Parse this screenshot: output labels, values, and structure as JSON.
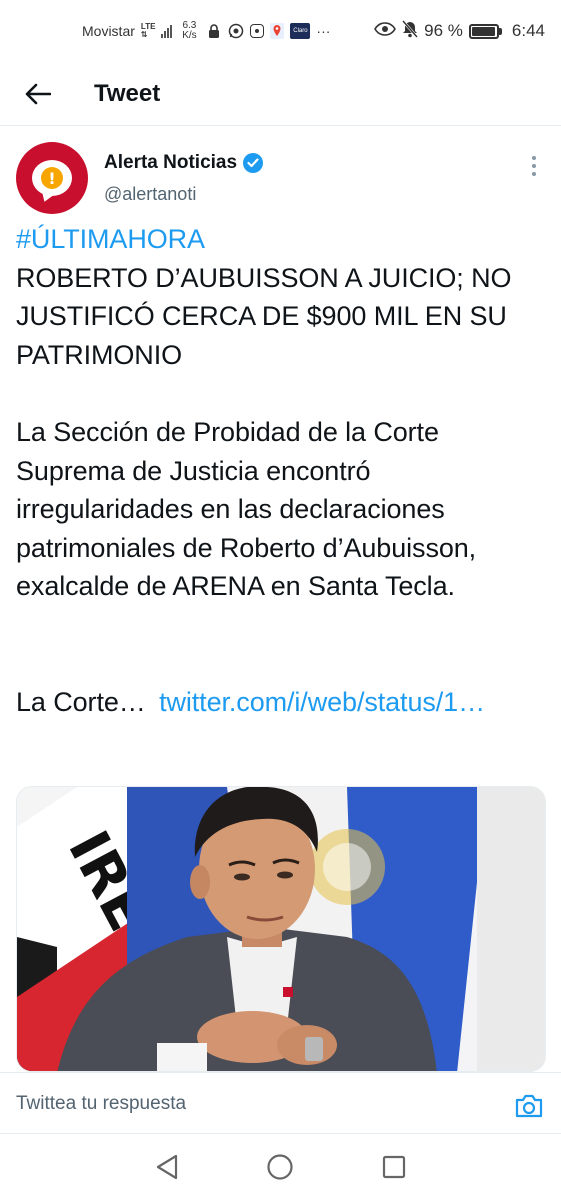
{
  "status_bar": {
    "carrier": "Movistar",
    "network": "LTE",
    "speed": "6.3 K/s",
    "speed_value": "6.3",
    "speed_unit": "K/s",
    "battery": "96 %",
    "battery_level": 0.96,
    "time": "6:44",
    "app_icon_label": "Claro"
  },
  "header": {
    "title": "Tweet"
  },
  "tweet": {
    "author_name": "Alerta Noticias",
    "handle": "@alertanoti",
    "hashtag": "#ÚLTIMAHORA",
    "headline": "ROBERTO D’AUBUISSON A JUICIO; NO JUSTIFICÓ CERCA DE $900 MIL EN SU PATRIMONIO",
    "body": "La Sección de Probidad de la Corte Suprema de Justicia encontró irregularidades en las declaraciones patrimoniales de Roberto d’Aubuisson, exalcalde de ARENA en Santa Tecla.",
    "truncated_text": "La Corte…",
    "link": "twitter.com/i/web/status/1…",
    "image_sign_text": "IRE"
  },
  "reply": {
    "placeholder": "Twittea tu respuesta"
  },
  "colors": {
    "accent": "#1d9bf0",
    "avatar_bg": "#c8102e",
    "text_primary": "#0f1419",
    "text_secondary": "#536471"
  }
}
